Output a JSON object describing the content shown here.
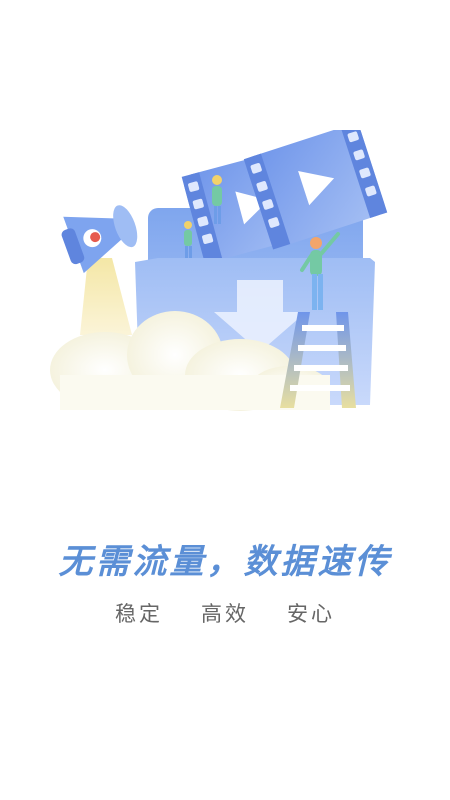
{
  "splash": {
    "headline": "无需流量，数据速传",
    "features": [
      "稳定",
      "高效",
      "安心"
    ]
  },
  "illustration": {
    "icons": [
      "megaphone-icon",
      "folder-icon",
      "download-arrow-icon",
      "video-film-icon",
      "play-icon",
      "ladder-icon",
      "person-figure-icon",
      "cloud-icon"
    ]
  },
  "colors": {
    "accent": "#5b8fd6",
    "secondary_text": "#666666",
    "background": "#ffffff"
  }
}
